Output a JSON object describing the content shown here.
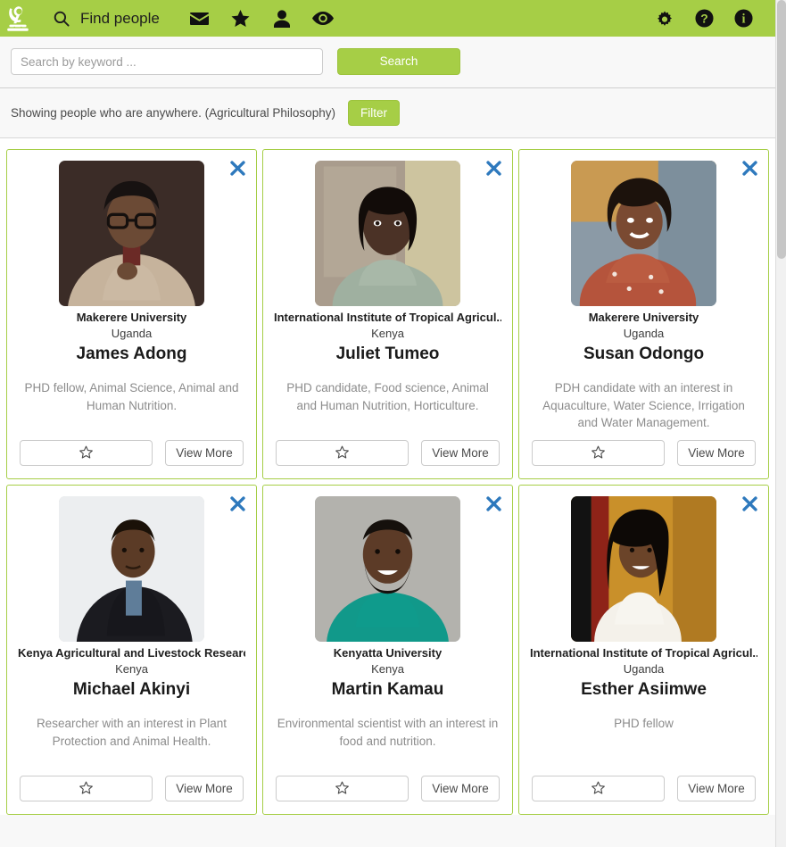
{
  "app": {
    "logo_icon": "microscope-icon",
    "brand_color": "#a6ce46",
    "accent_blue": "#2e79bd"
  },
  "topnav": {
    "title": "Find people",
    "search_icon": "search-icon",
    "items": [
      {
        "icon": "envelope-icon",
        "name": "messages"
      },
      {
        "icon": "star-icon",
        "name": "favourites"
      },
      {
        "icon": "person-icon",
        "name": "profile"
      },
      {
        "icon": "eye-icon",
        "name": "views"
      }
    ],
    "right_items": [
      {
        "icon": "gear-icon",
        "name": "settings"
      },
      {
        "icon": "question-circle-icon",
        "name": "help"
      },
      {
        "icon": "info-circle-icon",
        "name": "about"
      }
    ]
  },
  "search": {
    "placeholder": "Search by keyword ...",
    "value": "",
    "button_label": "Search"
  },
  "filter": {
    "status_text": "Showing people who are anywhere. (Agricultural Philosophy)",
    "button_label": "Filter"
  },
  "card_actions": {
    "favourite_icon": "star-outline-icon",
    "view_more_label": "View More",
    "close_icon": "close-x-icon"
  },
  "people": [
    {
      "affiliation": "Makerere University",
      "country": "Uganda",
      "name": "James Adong",
      "bio": "PHD fellow, Animal Science, Animal and Human Nutrition.",
      "photo": "man-glasses-beige-blazer-dark-background"
    },
    {
      "affiliation": "International Institute of Tropical Agricul...",
      "country": "Kenya",
      "name": "Juliet Tumeo",
      "bio": "PHD candidate, Food science, Animal and Human Nutrition, Horticulture.",
      "photo": "woman-braids-green-top-doorway"
    },
    {
      "affiliation": "Makerere University",
      "country": "Uganda",
      "name": "Susan Odongo",
      "bio": "PDH candidate with an interest in Aquaculture, Water Science, Irrigation and Water Management.",
      "photo": "woman-curly-hair-floral-top-outdoors"
    },
    {
      "affiliation": "Kenya Agricultural and Livestock Researc...",
      "country": "Kenya",
      "name": "Michael Akinyi",
      "bio": "Researcher with an interest in Plant Protection and Animal Health.",
      "photo": "man-dark-suit-white-background"
    },
    {
      "affiliation": "Kenyatta University",
      "country": "Kenya",
      "name": "Martin Kamau",
      "bio": "Environmental scientist with an interest in food and nutrition.",
      "photo": "man-beard-teal-polo-grey-background"
    },
    {
      "affiliation": "International Institute of Tropical Agricul...",
      "country": "Uganda",
      "name": "Esther Asiimwe",
      "bio": "PHD fellow",
      "photo": "woman-long-hair-white-dress-gold-background"
    }
  ]
}
